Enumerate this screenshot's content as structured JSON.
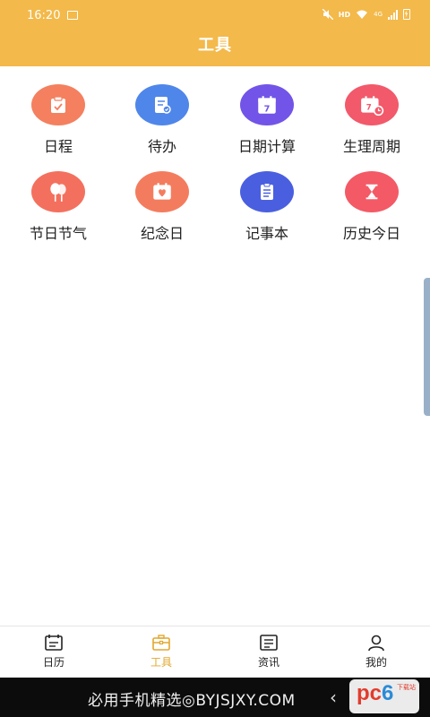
{
  "status_bar": {
    "time": "16:20",
    "hd": "HD",
    "network": "4G"
  },
  "header": {
    "title": "工具"
  },
  "tools": [
    {
      "label": "日程",
      "icon": "schedule-icon",
      "color": "#f4805f"
    },
    {
      "label": "待办",
      "icon": "todo-icon",
      "color": "#4f86ea"
    },
    {
      "label": "日期计算",
      "icon": "date-calc-icon",
      "color": "#7254e8"
    },
    {
      "label": "生理周期",
      "icon": "period-icon",
      "color": "#f2596a"
    },
    {
      "label": "节日节气",
      "icon": "festival-icon",
      "color": "#f4705e"
    },
    {
      "label": "纪念日",
      "icon": "anniversary-icon",
      "color": "#f47c5e"
    },
    {
      "label": "记事本",
      "icon": "notebook-icon",
      "color": "#4a5fe0"
    },
    {
      "label": "历史今日",
      "icon": "history-icon",
      "color": "#f35a66"
    }
  ],
  "tabbar": {
    "items": [
      {
        "label": "日历",
        "icon": "calendar-icon",
        "active": false
      },
      {
        "label": "工具",
        "icon": "toolbox-icon",
        "active": true
      },
      {
        "label": "资讯",
        "icon": "news-icon",
        "active": false
      },
      {
        "label": "我的",
        "icon": "profile-icon",
        "active": false
      }
    ],
    "active_color": "#e2a72e"
  },
  "bottom_bar": {
    "text": "必用手机精选◎BYJSJXY.COM"
  },
  "watermark": {
    "brand_a": "pc",
    "brand_b": "6",
    "sub": "下载站"
  }
}
